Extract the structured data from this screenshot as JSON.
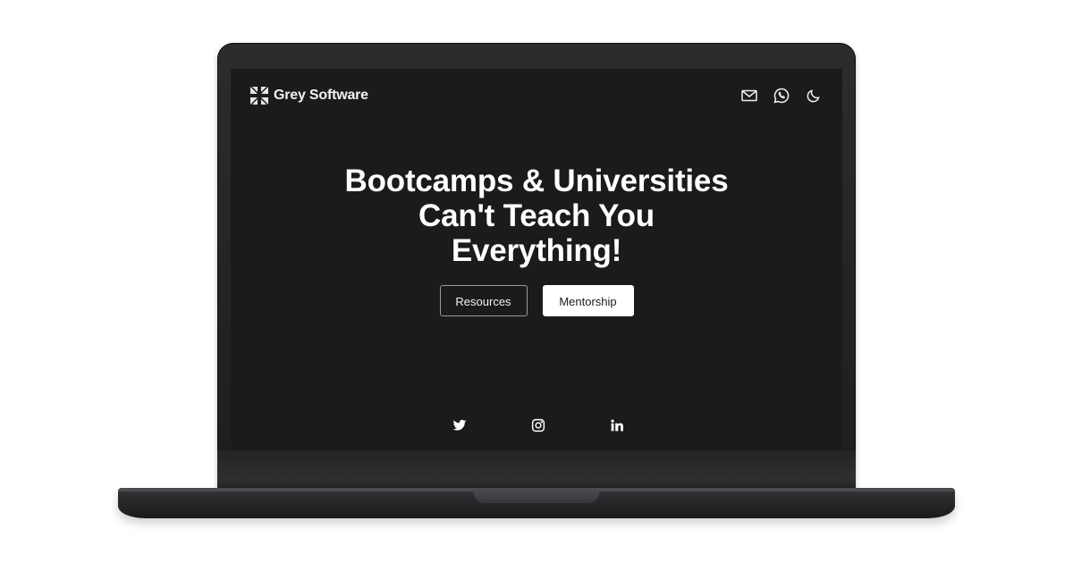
{
  "brand": {
    "name": "Grey Software",
    "logo_icon": "grey-software-logo-icon"
  },
  "nav": {
    "icons": [
      "mail-icon",
      "whatsapp-icon",
      "moon-icon"
    ]
  },
  "hero": {
    "title_lines": [
      "Bootcamps & Universities",
      "Can't Teach You",
      "Everything!"
    ]
  },
  "buttons": {
    "resources": "Resources",
    "mentorship": "Mentorship"
  },
  "socials": [
    "twitter-icon",
    "instagram-icon",
    "linkedin-icon"
  ],
  "colors": {
    "screen_bg": "#1b1b1b",
    "text": "#ffffff",
    "laptop_body": "#2b2c2e"
  }
}
